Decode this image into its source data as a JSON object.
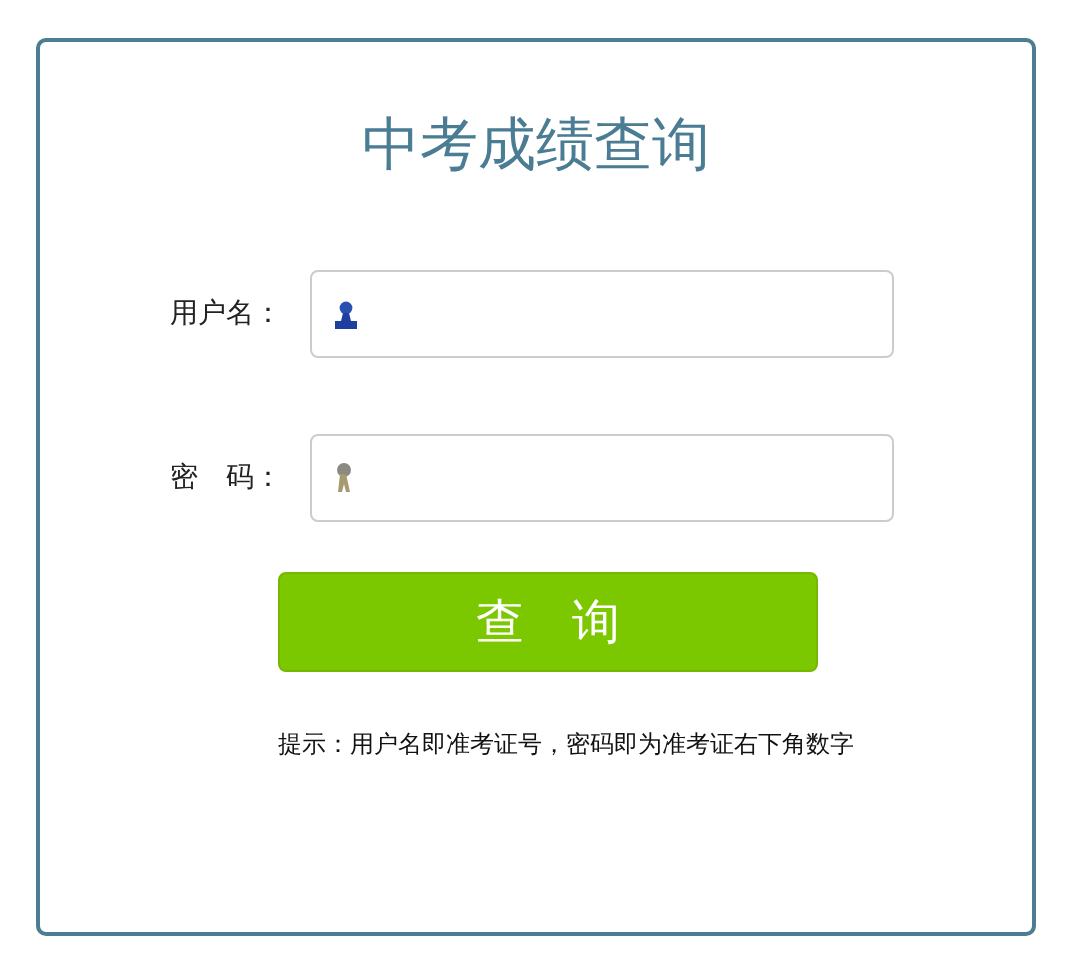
{
  "title": "中考成绩查询",
  "fields": [
    {
      "label": "用户名：",
      "kind": "user"
    },
    {
      "label": "密　码：",
      "kind": "password"
    }
  ],
  "submit": "查　询",
  "hint": "提示：用户名即准考证号，密码即为准考证右下角数字"
}
